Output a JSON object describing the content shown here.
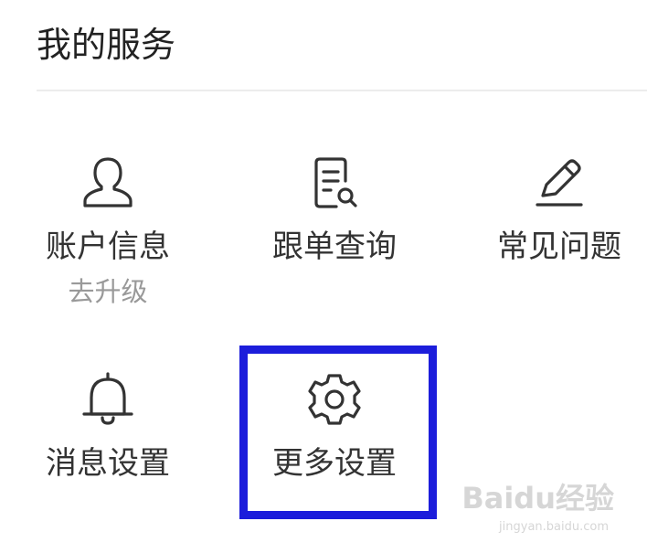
{
  "section": {
    "title": "我的服务"
  },
  "services": [
    {
      "label": "账户信息",
      "sublabel": "去升级",
      "icon": "user-icon"
    },
    {
      "label": "跟单查询",
      "icon": "document-search-icon"
    },
    {
      "label": "常见问题",
      "icon": "pencil-icon"
    },
    {
      "label": "消息设置",
      "icon": "bell-icon"
    },
    {
      "label": "更多设置",
      "icon": "gear-icon"
    }
  ],
  "watermark": {
    "text": "Baidu经验",
    "sub": "jingyan.baidu.com"
  },
  "colors": {
    "highlight": "#1c1ddb",
    "text": "#333333",
    "subtext": "#999999",
    "divider": "#ececec"
  }
}
